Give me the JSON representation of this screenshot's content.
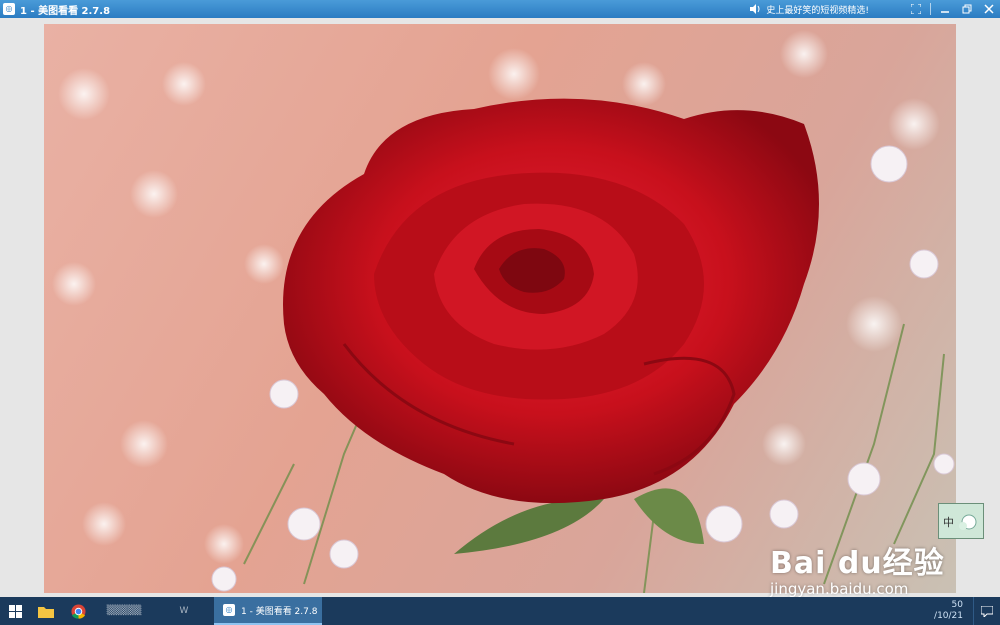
{
  "window": {
    "title": "1 - 美图看看 2.7.8",
    "promo_text": "史上最好笑的短视频精选!",
    "icons": [
      "speaker-icon",
      "fullscreen-icon",
      "minimize-icon",
      "restore-icon",
      "close-icon"
    ]
  },
  "viewer": {
    "thumbnail_label": "中",
    "watermark": {
      "logo": "Bai du经验",
      "url": "jingyan.baidu.com"
    }
  },
  "taskbar": {
    "active_task_label": "1 - 美图看看 2.7.8",
    "blurred_task_label": "W",
    "date_text": "/10/21",
    "time_text": "50"
  },
  "colors": {
    "titlebar": "#2b7cc2",
    "taskbar": "#1b3a5c",
    "rose": "#c8101c"
  }
}
